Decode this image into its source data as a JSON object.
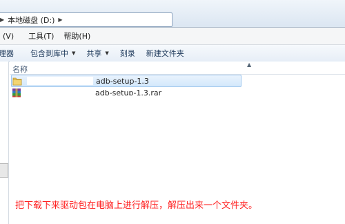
{
  "address": {
    "segments": [
      "本地磁盘 (D:)"
    ],
    "icons": [
      "chevron-right-icon",
      "drive-icon"
    ]
  },
  "menu": {
    "items": [
      "(V)",
      "工具(T)",
      "帮助(H)"
    ]
  },
  "toolbar": {
    "items": [
      {
        "label": "理器",
        "dropdown": false
      },
      {
        "label": "包含到库中",
        "dropdown": true
      },
      {
        "label": "共享",
        "dropdown": true
      },
      {
        "label": "刻录",
        "dropdown": false
      },
      {
        "label": "新建文件夹",
        "dropdown": false
      }
    ]
  },
  "columns": {
    "name": "名称"
  },
  "files": [
    {
      "name": "adb-setup-1.3",
      "type": "folder",
      "selected": true
    },
    {
      "name": "adb-setup-1.3.rar",
      "type": "rar-archive",
      "selected": false
    }
  ],
  "caption": "把下载下来驱动包在电脑上进行解压，解压出来一个文件夹。",
  "colors": {
    "caption": "#ff2020",
    "selection": "#d4e8fb",
    "toolbar_text": "#1e395b"
  }
}
